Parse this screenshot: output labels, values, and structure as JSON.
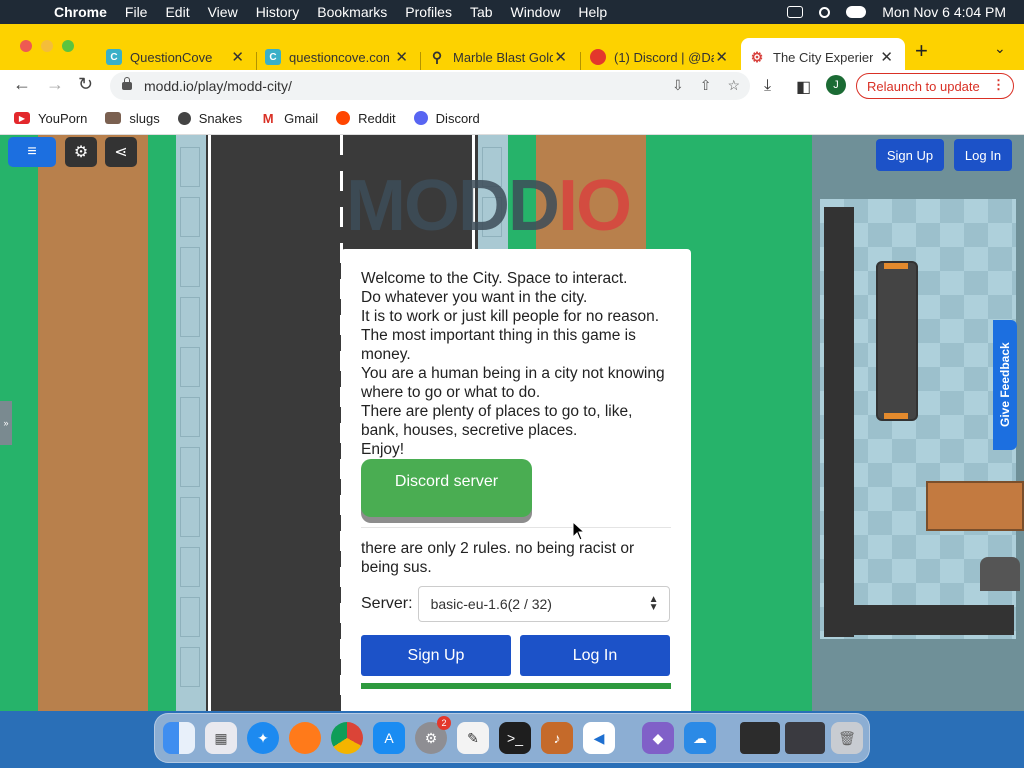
{
  "menubar": {
    "app": "Chrome",
    "items": [
      "File",
      "Edit",
      "View",
      "History",
      "Bookmarks",
      "Profiles",
      "Tab",
      "Window",
      "Help"
    ],
    "clock": "Mon Nov 6  4:04 PM"
  },
  "tabs": [
    {
      "title": "QuestionCove",
      "color": "#3ab0c8"
    },
    {
      "title": "questioncove.com",
      "color": "#3ab0c8"
    },
    {
      "title": "Marble Blast Gold",
      "color": "#555555"
    },
    {
      "title": "(1) Discord | @Da",
      "color": "#e3382c"
    },
    {
      "title": "The City Experience",
      "color": "#d8433f"
    }
  ],
  "toolbar": {
    "url": "modd.io/play/modd-city/",
    "avatar_letter": "J",
    "relaunch_label": "Relaunch to update"
  },
  "bookmarks": [
    {
      "label": "YouPorn",
      "color": "#e3282c"
    },
    {
      "label": "slugs",
      "color": "#7a6050"
    },
    {
      "label": "Snakes",
      "color": "#444444"
    },
    {
      "label": "Gmail",
      "color": "#d93025"
    },
    {
      "label": "Reddit",
      "color": "#ff4500"
    },
    {
      "label": "Discord",
      "color": "#5865f2"
    }
  ],
  "game": {
    "signup_label": "Sign Up",
    "login_label": "Log In",
    "feedback_label": "Give Feedback",
    "logo_left": "MODD",
    "logo_right": "IO",
    "side_tab": "»"
  },
  "modal": {
    "welcome_lines": [
      "Welcome to the City. Space to interact.",
      "Do whatever you want in the city.",
      "It is to work or just kill people for no reason.",
      "The most important thing in this game is money.",
      "You are a human being in a city not knowing where to go or what to do.",
      "There are plenty of places to go to, like, bank, houses, secretive places.",
      "Enjoy!"
    ],
    "discord_label": "Discord server",
    "rules": "there are only 2 rules. no being racist or being sus.",
    "server_label": "Server:",
    "server_value": "basic-eu-1.6(2 / 32)",
    "signup_label": "Sign Up",
    "login_label": "Log In"
  },
  "dock": {
    "badge": "2"
  }
}
